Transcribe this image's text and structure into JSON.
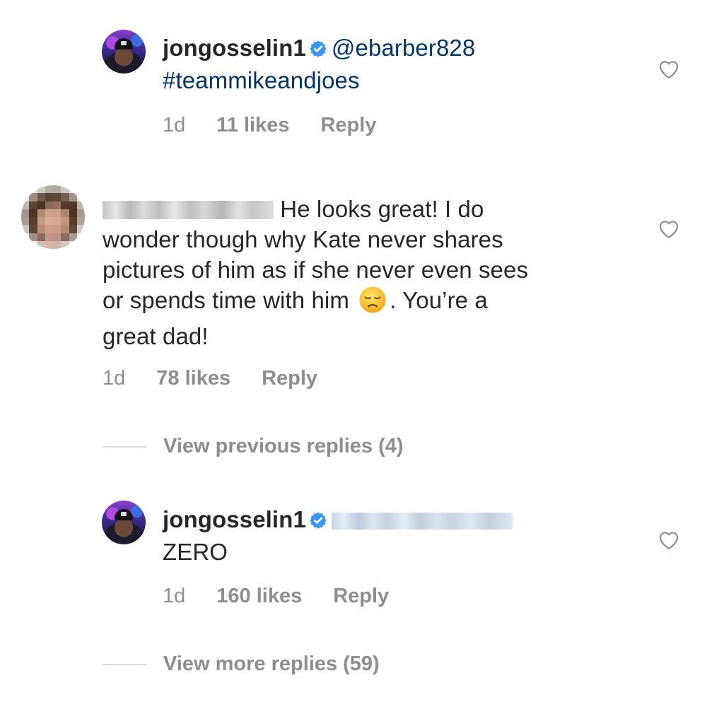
{
  "comments": [
    {
      "username": "jongosselin1",
      "verified": true,
      "mention": "@ebarber828",
      "text_lines": [
        "#teammikeandjoes"
      ],
      "time": "1d",
      "likes": "11 likes",
      "reply_label": "Reply"
    },
    {
      "username_blurred": true,
      "text_first": "He looks great! I do",
      "text_lines": [
        "wonder though why Kate never shares",
        "pictures of him as if she never even sees"
      ],
      "text_line4_before_emoji": "or spends time with him",
      "emoji": "disappointed-face",
      "text_line4_after_emoji": ". You’re a",
      "text_line5": "great dad!",
      "time": "1d",
      "likes": "78 likes",
      "reply_label": "Reply"
    },
    {
      "username": "jongosselin1",
      "verified": true,
      "mention_blurred": true,
      "text_lines": [
        "ZERO"
      ],
      "time": "1d",
      "likes": "160 likes",
      "reply_label": "Reply"
    }
  ],
  "view_previous_replies": "View previous replies (4)",
  "view_more_replies": "View more replies (59)",
  "icons": {
    "like": "heart-outline-icon",
    "verified": "verified-badge-icon"
  },
  "colors": {
    "text": "#262626",
    "mention": "#003569",
    "meta": "#8e8e8e",
    "verified": "#3897f0"
  }
}
